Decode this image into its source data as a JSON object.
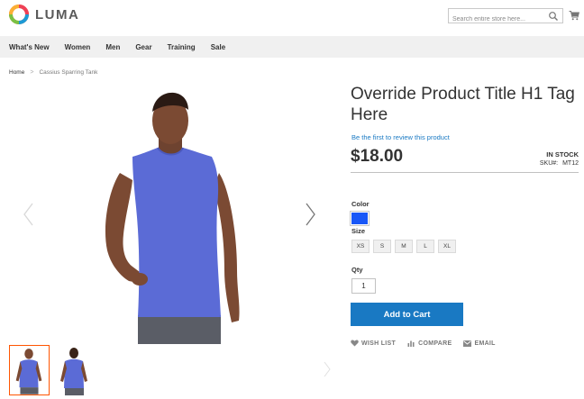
{
  "brand": {
    "name": "LUMA"
  },
  "search": {
    "placeholder": "Search entire store here..."
  },
  "nav": {
    "items": [
      {
        "label": "What's New"
      },
      {
        "label": "Women"
      },
      {
        "label": "Men"
      },
      {
        "label": "Gear"
      },
      {
        "label": "Training"
      },
      {
        "label": "Sale"
      }
    ]
  },
  "breadcrumb": {
    "home": "Home",
    "separator": ">",
    "current": "Cassius Sparring Tank"
  },
  "product": {
    "title": "Override Product Title H1 Tag Here",
    "review_link": "Be the first to review this product",
    "price": "$18.00",
    "stock": "IN STOCK",
    "sku_label": "SKU#:",
    "sku": "MT12",
    "color_label": "Color",
    "color_swatch": "#1857f7",
    "size_label": "Size",
    "sizes": [
      "XS",
      "S",
      "M",
      "L",
      "XL"
    ],
    "qty_label": "Qty",
    "qty": "1",
    "add_to_cart": "Add to Cart",
    "actions": {
      "wishlist": "WISH LIST",
      "compare": "COMPARE",
      "email": "EMAIL"
    }
  },
  "colors": {
    "accent": "#1979c3",
    "thumb_active": "#ff5501",
    "shirt": "#5b6bd6"
  }
}
